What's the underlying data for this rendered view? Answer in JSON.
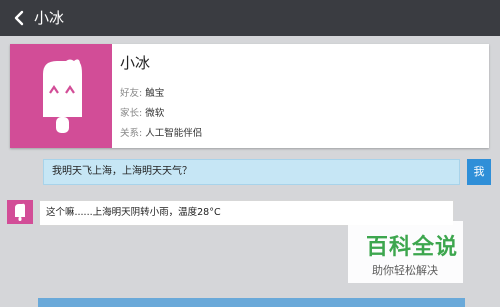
{
  "header": {
    "title": "小冰"
  },
  "profile": {
    "name": "小冰",
    "friend_label": "好友:",
    "friend_value": "触宝",
    "parent_label": "家长:",
    "parent_value": "微软",
    "relation_label": "关系:",
    "relation_value": "人工智能伴侣"
  },
  "chat": {
    "user_message": "我明天飞上海，上海明天天气？",
    "user_tag": "我",
    "bot_message": "这个嘛......上海明天阴转小雨，温度28°C"
  },
  "watermark": {
    "title": "百科全说",
    "subtitle": "助你轻松解决"
  },
  "colors": {
    "topbar": "#3a3c41",
    "accent_pink": "#d24d97",
    "user_bubble": "#c6e6f5",
    "user_tag": "#2f8fd8",
    "brand_green": "#35a447"
  }
}
